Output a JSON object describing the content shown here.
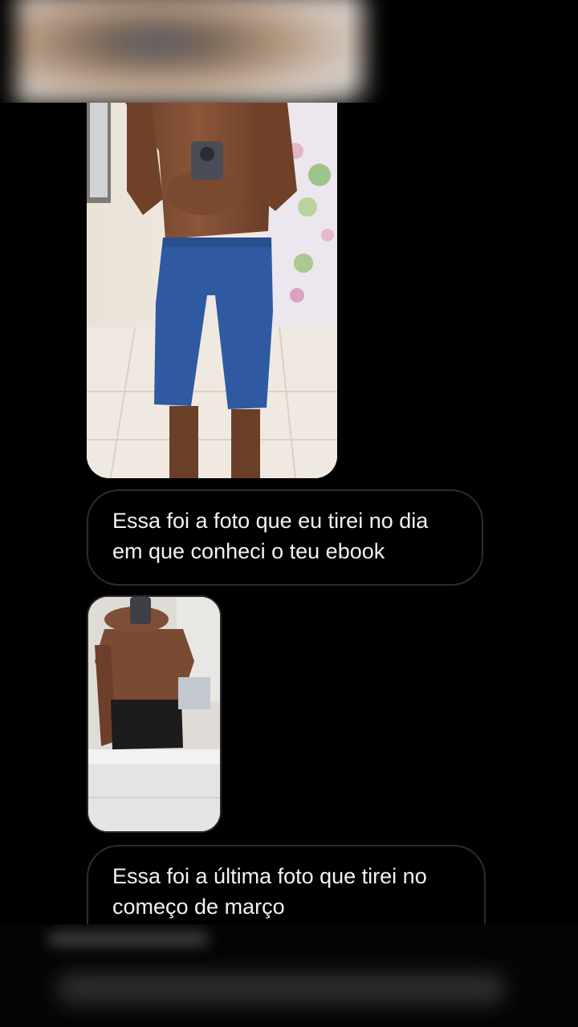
{
  "conversation": {
    "messages": [
      {
        "type": "image",
        "description_icon": "selfie-photo-icon"
      },
      {
        "type": "text",
        "lines": [
          "Essa foi a foto que eu tirei no dia",
          "em que conheci o teu ebook"
        ]
      },
      {
        "type": "image",
        "description_icon": "selfie-photo-icon"
      },
      {
        "type": "text",
        "lines": [
          "Essa foi a última foto que tirei no",
          "começo de março"
        ]
      }
    ]
  },
  "colors": {
    "background": "#000000",
    "bubble_border": "#2d2d2d",
    "text": "#f2f2f2"
  }
}
